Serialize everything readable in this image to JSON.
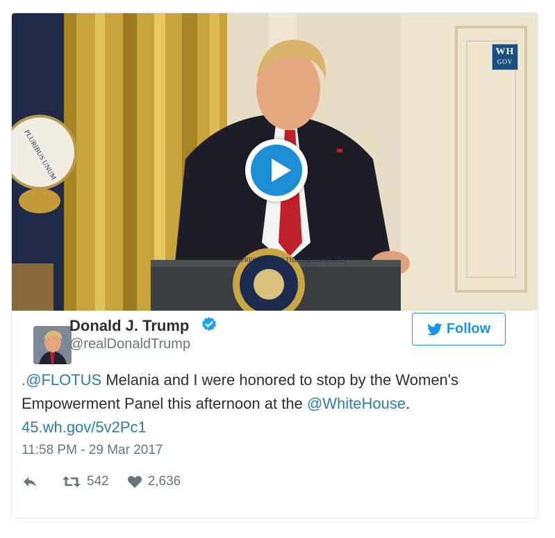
{
  "media": {
    "watermark": {
      "line1": "WH",
      "line2": "GOV"
    },
    "seal_text": "PRESIDENT OF THE UNITED STATES",
    "flag_text": "PLURIBUS UNUM"
  },
  "author": {
    "name": "Donald J. Trump",
    "handle": "@realDonaldTrump",
    "verified": true
  },
  "follow_label": "Follow",
  "tweet": {
    "mention_flotus": ".@FLOTUS",
    "text_part1": " Melania and I were honored to stop by the Women's",
    "text_part2": "Empowerment Panel this afternoon at the ",
    "mention_whitehouse": "@WhiteHouse",
    "text_part3": ".",
    "link": "45.wh.gov/5v2Pc1"
  },
  "timestamp": "11:58 PM - 29 Mar 2017",
  "actions": {
    "retweets": "542",
    "likes": "2,636"
  },
  "colors": {
    "link": "#2b7bb9",
    "accent": "#1b95e0",
    "play_button": "#1c8ed6",
    "muted": "#66757f"
  }
}
